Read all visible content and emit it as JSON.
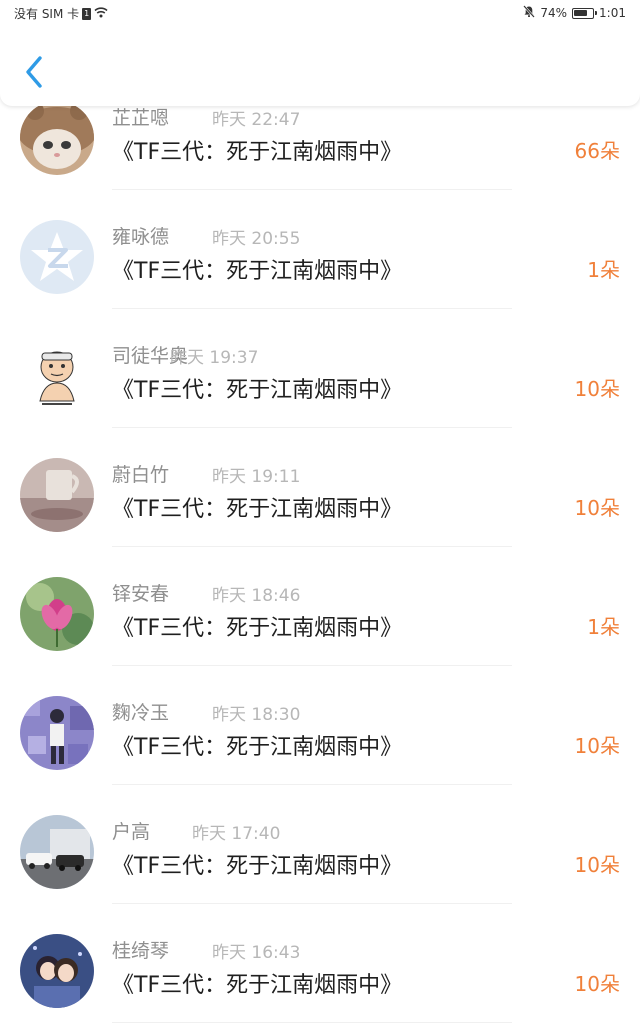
{
  "status_bar": {
    "carrier": "没有 SIM 卡",
    "sim_slot": "1",
    "battery_percent": "74%",
    "battery_level": 0.74,
    "time": "1:01"
  },
  "header": {
    "back_icon": "chevron-left-icon",
    "accent_color": "#2f9be6"
  },
  "colors": {
    "amount": "#f0803a",
    "name": "#8f8f8f",
    "time": "#b7b7b7",
    "book": "#1f1f1f"
  },
  "records": [
    {
      "name": "芷芷嗯",
      "time": "昨天 22:47",
      "book": "《TF三代：死于江南烟雨中》",
      "amount": "66朵",
      "avatar": "cat-hat-avatar"
    },
    {
      "name": "雍咏德",
      "time": "昨天 20:55",
      "book": "《TF三代：死于江南烟雨中》",
      "amount": "1朵",
      "avatar": "qq-default-avatar"
    },
    {
      "name": "司徒华奥",
      "time": "昨天 19:37",
      "book": "《TF三代：死于江南烟雨中》",
      "amount": "10朵",
      "avatar": "cartoon-meme-avatar"
    },
    {
      "name": "蔚白竹",
      "time": "昨天 19:11",
      "book": "《TF三代：死于江南烟雨中》",
      "amount": "10朵",
      "avatar": "cup-photo-avatar"
    },
    {
      "name": "铎安春",
      "time": "昨天 18:46",
      "book": "《TF三代：死于江南烟雨中》",
      "amount": "1朵",
      "avatar": "flower-avatar"
    },
    {
      "name": "麴冷玉",
      "time": "昨天 18:30",
      "book": "《TF三代：死于江南烟雨中》",
      "amount": "10朵",
      "avatar": "pixel-person-avatar"
    },
    {
      "name": "户高",
      "time": "昨天 17:40",
      "book": "《TF三代：死于江南烟雨中》",
      "amount": "10朵",
      "avatar": "cars-avatar"
    },
    {
      "name": "桂绮琴",
      "time": "昨天 16:43",
      "book": "《TF三代：死于江南烟雨中》",
      "amount": "10朵",
      "avatar": "anime-couple-avatar"
    }
  ]
}
